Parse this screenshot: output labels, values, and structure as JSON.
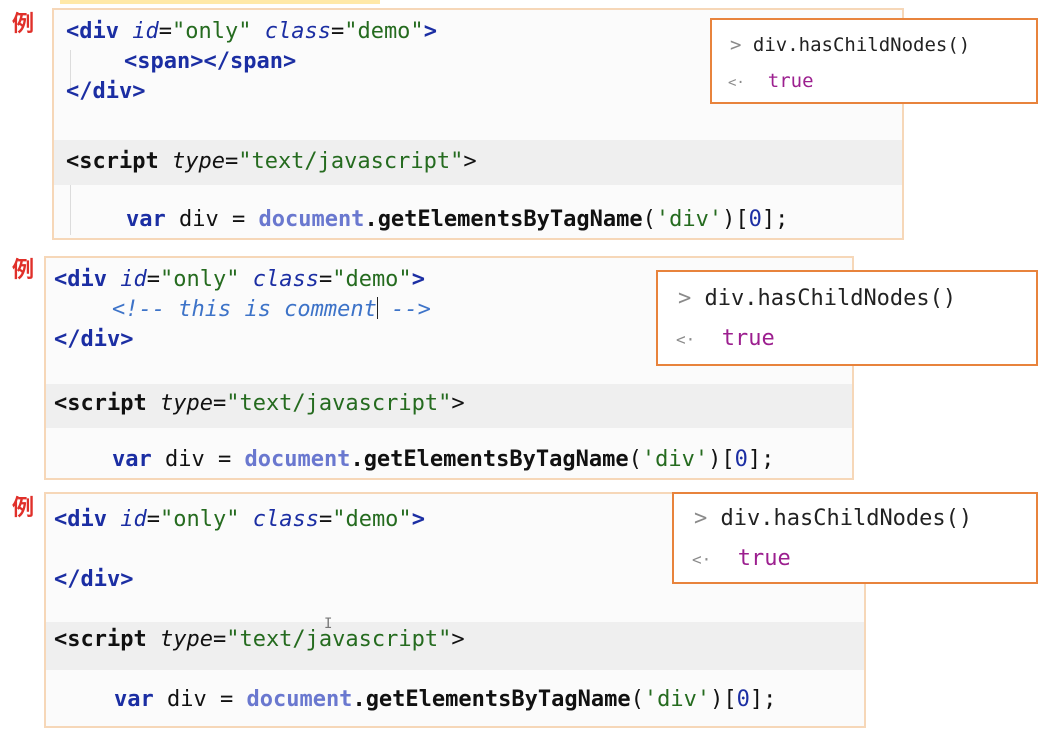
{
  "marker_char": "例",
  "examples": [
    {
      "code": {
        "line1": {
          "open": "<div ",
          "attr1": "id",
          "eq1": "=",
          "val1": "\"only\"",
          "attr2": "class",
          "eq2": "=",
          "val2": "\"demo\"",
          "close": ">"
        },
        "line2": {
          "open": "<span></span>"
        },
        "line3": {
          "close": "</div>"
        },
        "script_line": {
          "open": "<script ",
          "attr": "type",
          "eq": "=",
          "val": "\"text/javascript\"",
          "close": ">"
        },
        "js_line": {
          "kw": "var",
          "name": " div = ",
          "obj": "document",
          "dot": ".",
          "method": "getElementsByTagName",
          "arg_open": "(",
          "arg": "'div'",
          "arg_close": ")[",
          "idx": "0",
          "end": "];"
        }
      },
      "console": {
        "in_prompt": ">",
        "command": "div.hasChildNodes()",
        "out_prompt": "<·",
        "result": "true"
      }
    },
    {
      "code": {
        "line1": {
          "open": "<div ",
          "attr1": "id",
          "eq1": "=",
          "val1": "\"only\"",
          "attr2": "class",
          "eq2": "=",
          "val2": "\"demo\"",
          "close": ">"
        },
        "comment_a": "<!-- this is comment",
        "comment_b": " -->",
        "line3": {
          "close": "</div>"
        },
        "script_line": {
          "open": "<script ",
          "attr": "type",
          "eq": "=",
          "val": "\"text/javascript\"",
          "close": ">"
        },
        "js_line": {
          "kw": "var",
          "name": " div = ",
          "obj": "document",
          "dot": ".",
          "method": "getElementsByTagName",
          "arg_open": "(",
          "arg": "'div'",
          "arg_close": ")[",
          "idx": "0",
          "end": "];"
        }
      },
      "console": {
        "in_prompt": ">",
        "command": "div.hasChildNodes()",
        "out_prompt": "<·",
        "result": "true"
      }
    },
    {
      "code": {
        "line1": {
          "open": "<div ",
          "attr1": "id",
          "eq1": "=",
          "val1": "\"only\"",
          "attr2": "class",
          "eq2": "=",
          "val2": "\"demo\"",
          "close": ">"
        },
        "line3": {
          "close": "</div>"
        },
        "script_line": {
          "open": "<script ",
          "attr": "type",
          "eq": "=",
          "val": "\"text/javascript\"",
          "close": ">"
        },
        "js_line": {
          "kw": "var",
          "name": " div = ",
          "obj": "document",
          "dot": ".",
          "method": "getElementsByTagName",
          "arg_open": "(",
          "arg": "'div'",
          "arg_close": ")[",
          "idx": "0",
          "end": "];"
        }
      },
      "console": {
        "in_prompt": ">",
        "command": "div.hasChildNodes()",
        "out_prompt": "<·",
        "result": "true"
      }
    }
  ],
  "text_cursor_glyph": "I"
}
